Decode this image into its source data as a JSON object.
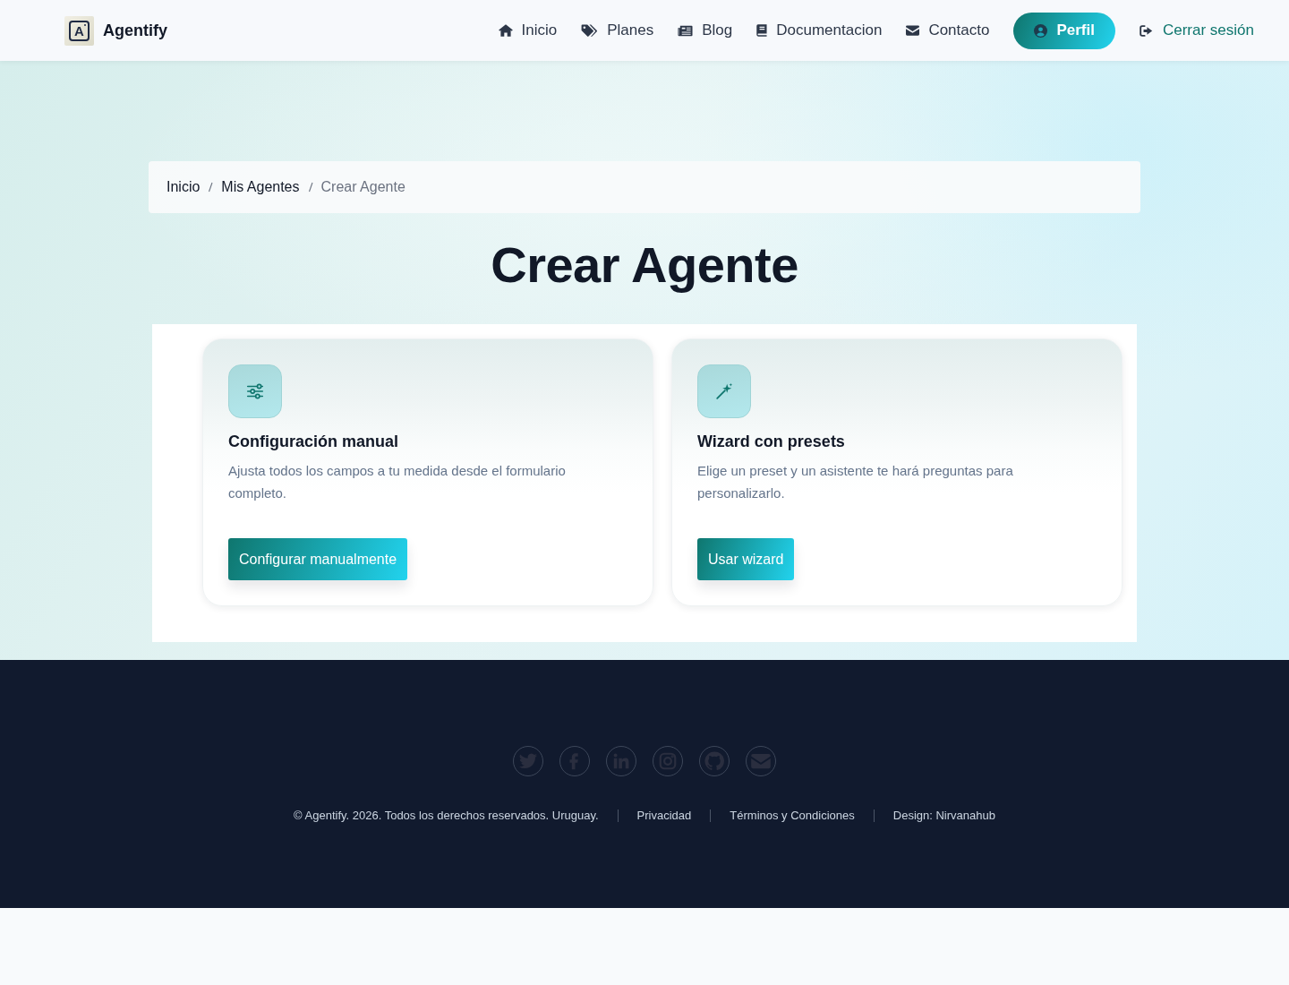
{
  "header": {
    "logo_letter": "A",
    "brand": "Agentify",
    "nav": [
      "Inicio",
      "Planes",
      "Blog",
      "Documentacion",
      "Contacto"
    ],
    "profile_button": "Perfil",
    "logout_link": "Cerrar sesión"
  },
  "breadcrumb": [
    {
      "label": "Inicio",
      "current": false
    },
    {
      "label": "Mis Agentes",
      "current": false
    },
    {
      "label": "Crear Agente",
      "current": true
    }
  ],
  "title": "Crear Agente",
  "options": [
    {
      "title": "Configuración manual",
      "description": "Ajusta todos los campos a tu medida desde el formulario completo.",
      "button": "Configurar manualmente"
    },
    {
      "title": "Wizard con presets",
      "description": "Elige un preset y un asistente te hará preguntas para personalizarlo.",
      "button": "Usar wizard"
    }
  ],
  "footer": {
    "copyright": "© Agentify. 2026. Todos los derechos reservados. Uruguay.",
    "links": [
      "Privacidad",
      "Términos y Condiciones"
    ],
    "credit": "Design: Nirvanahub"
  }
}
